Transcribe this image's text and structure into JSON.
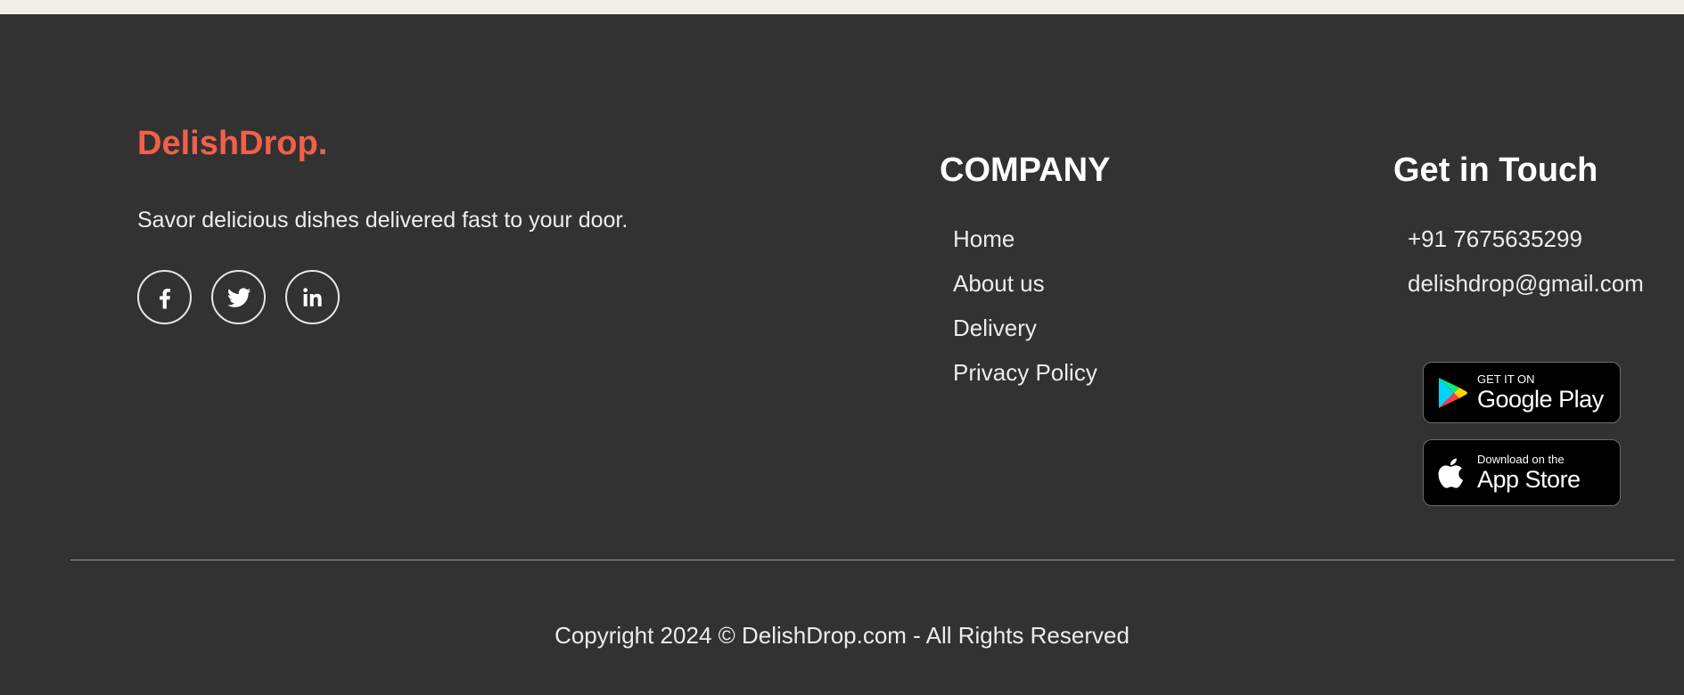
{
  "footer": {
    "brand": "DelishDrop.",
    "tagline": "Savor delicious dishes delivered fast to your door.",
    "social": [
      {
        "icon": "facebook-icon"
      },
      {
        "icon": "twitter-icon"
      },
      {
        "icon": "linkedin-icon"
      }
    ],
    "company": {
      "title": "COMPANY",
      "links": [
        "Home",
        "About us",
        "Delivery",
        "Privacy Policy"
      ]
    },
    "contact": {
      "title": "Get in Touch",
      "phone": "+91 7675635299",
      "email": "delishdrop@gmail.com"
    },
    "apps": {
      "google_play": {
        "small": "GET IT ON",
        "big": "Google Play"
      },
      "app_store": {
        "small": "Download on the",
        "big": "App Store"
      }
    },
    "copyright": "Copyright 2024 © DelishDrop.com - All Rights Reserved"
  },
  "colors": {
    "brand": "#f0604a",
    "background": "#323232",
    "top_strip": "#efeee9"
  }
}
